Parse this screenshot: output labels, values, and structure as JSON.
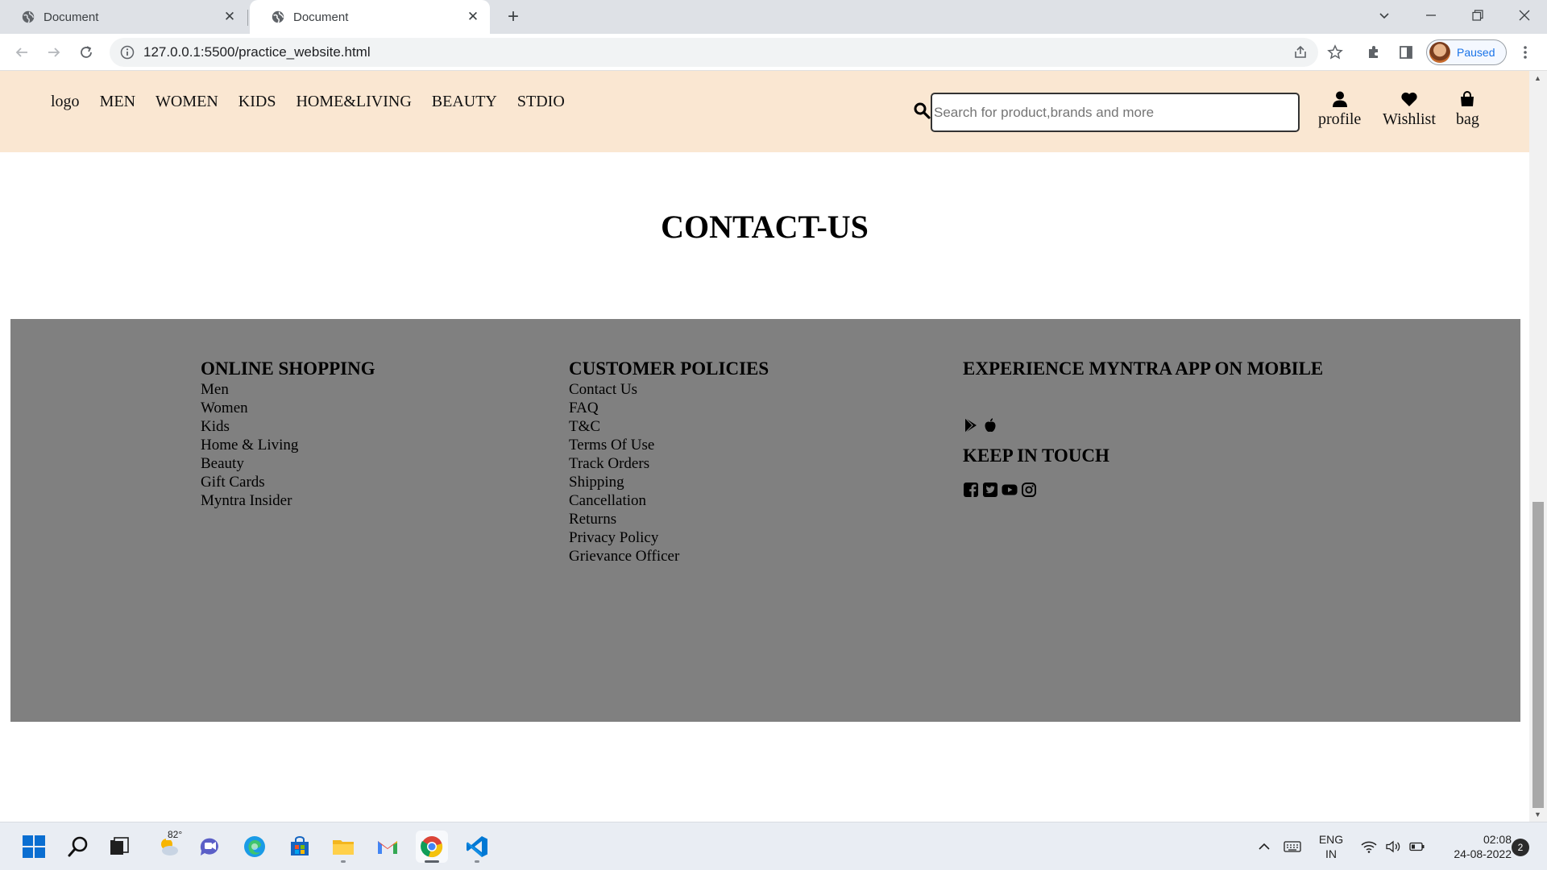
{
  "browser": {
    "tabs": [
      {
        "title": "Document",
        "active": false
      },
      {
        "title": "Document",
        "active": true
      }
    ],
    "url": "127.0.0.1:5500/practice_website.html",
    "profile_status": "Paused"
  },
  "header": {
    "nav_items": [
      "logo",
      "MEN",
      "WOMEN",
      "KIDS",
      "HOME&LIVING",
      "BEAUTY",
      "STDIO"
    ],
    "search_placeholder": "Search for product,brands and more",
    "actions": {
      "profile": "profile",
      "wishlist": "Wishlist",
      "bag": "bag"
    },
    "background_color": "#fae7d2"
  },
  "page": {
    "title": "CONTACT-US"
  },
  "footer": {
    "background_color": "#808080",
    "online_shopping": {
      "heading": "ONLINE SHOPPING",
      "links": [
        "Men",
        "Women",
        "Kids",
        "Home & Living",
        "Beauty",
        "Gift Cards",
        "Myntra Insider"
      ]
    },
    "customer_policies": {
      "heading": "CUSTOMER POLICIES",
      "links": [
        "Contact Us",
        "FAQ",
        "T&C",
        "Terms Of Use",
        "Track Orders",
        "Shipping",
        "Cancellation",
        "Returns",
        "Privacy Policy",
        "Grievance Officer"
      ]
    },
    "experience": {
      "heading": "EXPERIENCE MYNTRA APP ON MOBILE",
      "app_icons": [
        "google-play-icon",
        "apple-icon"
      ],
      "keep_in_touch_heading": "KEEP IN TOUCH",
      "social_icons": [
        "facebook-icon",
        "twitter-icon",
        "youtube-icon",
        "instagram-icon"
      ]
    }
  },
  "taskbar": {
    "weather_temp": "82°",
    "language": {
      "line1": "ENG",
      "line2": "IN"
    },
    "time": "02:08",
    "date": "24-08-2022",
    "notification_count": "2"
  }
}
